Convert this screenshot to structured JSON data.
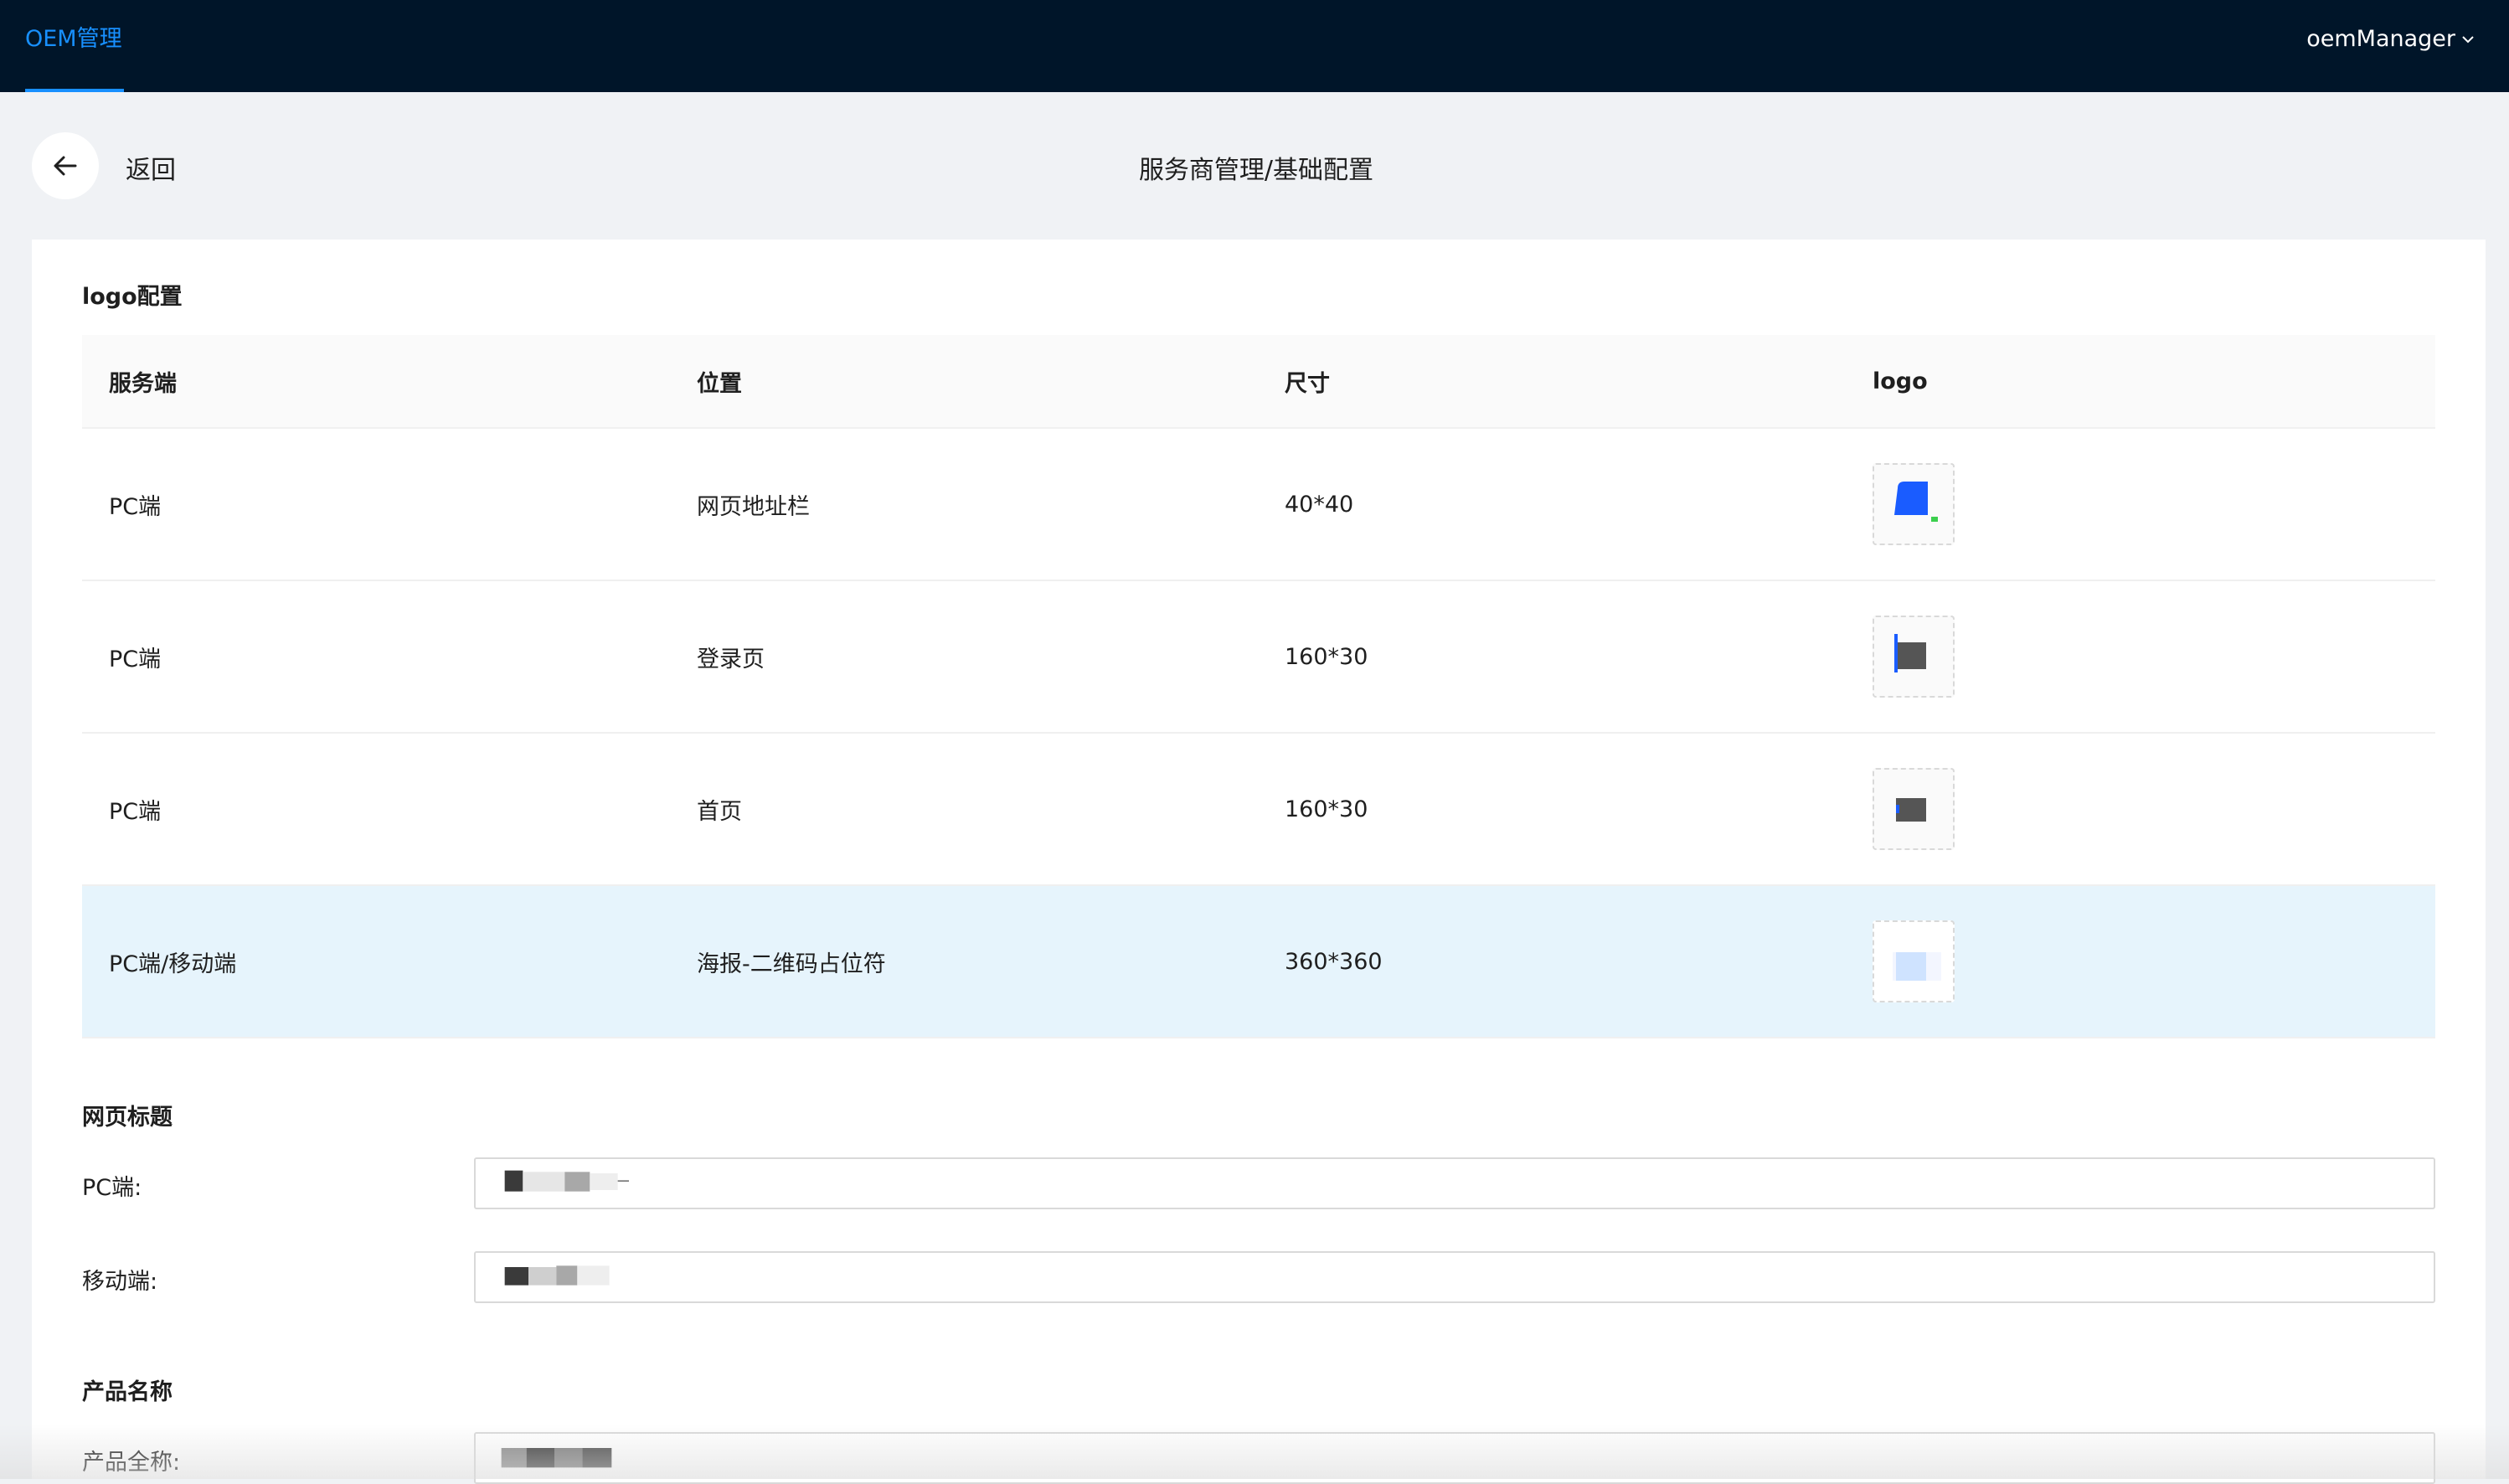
{
  "topbar": {
    "nav_item": "OEM管理",
    "user_name": "oemManager"
  },
  "header": {
    "back_label": "返回",
    "page_title": "服务商管理/基础配置"
  },
  "logo_section": {
    "title": "logo配置",
    "columns": [
      "服务端",
      "位置",
      "尺寸",
      "logo"
    ],
    "rows": [
      {
        "client": "PC端",
        "position": "网页地址栏",
        "size": "40*40"
      },
      {
        "client": "PC端",
        "position": "登录页",
        "size": "160*30"
      },
      {
        "client": "PC端",
        "position": "首页",
        "size": "160*30"
      },
      {
        "client": "PC端/移动端",
        "position": "海报-二维码占位符",
        "size": "360*360"
      }
    ]
  },
  "web_title_section": {
    "title": "网页标题",
    "pc_label": "PC端:",
    "mobile_label": "移动端:"
  },
  "product_section": {
    "title": "产品名称",
    "full_name_label": "产品全称:"
  },
  "colors": {
    "topbar_bg": "#001529",
    "accent": "#1890ff",
    "selected_row": "#e6f4fc"
  }
}
